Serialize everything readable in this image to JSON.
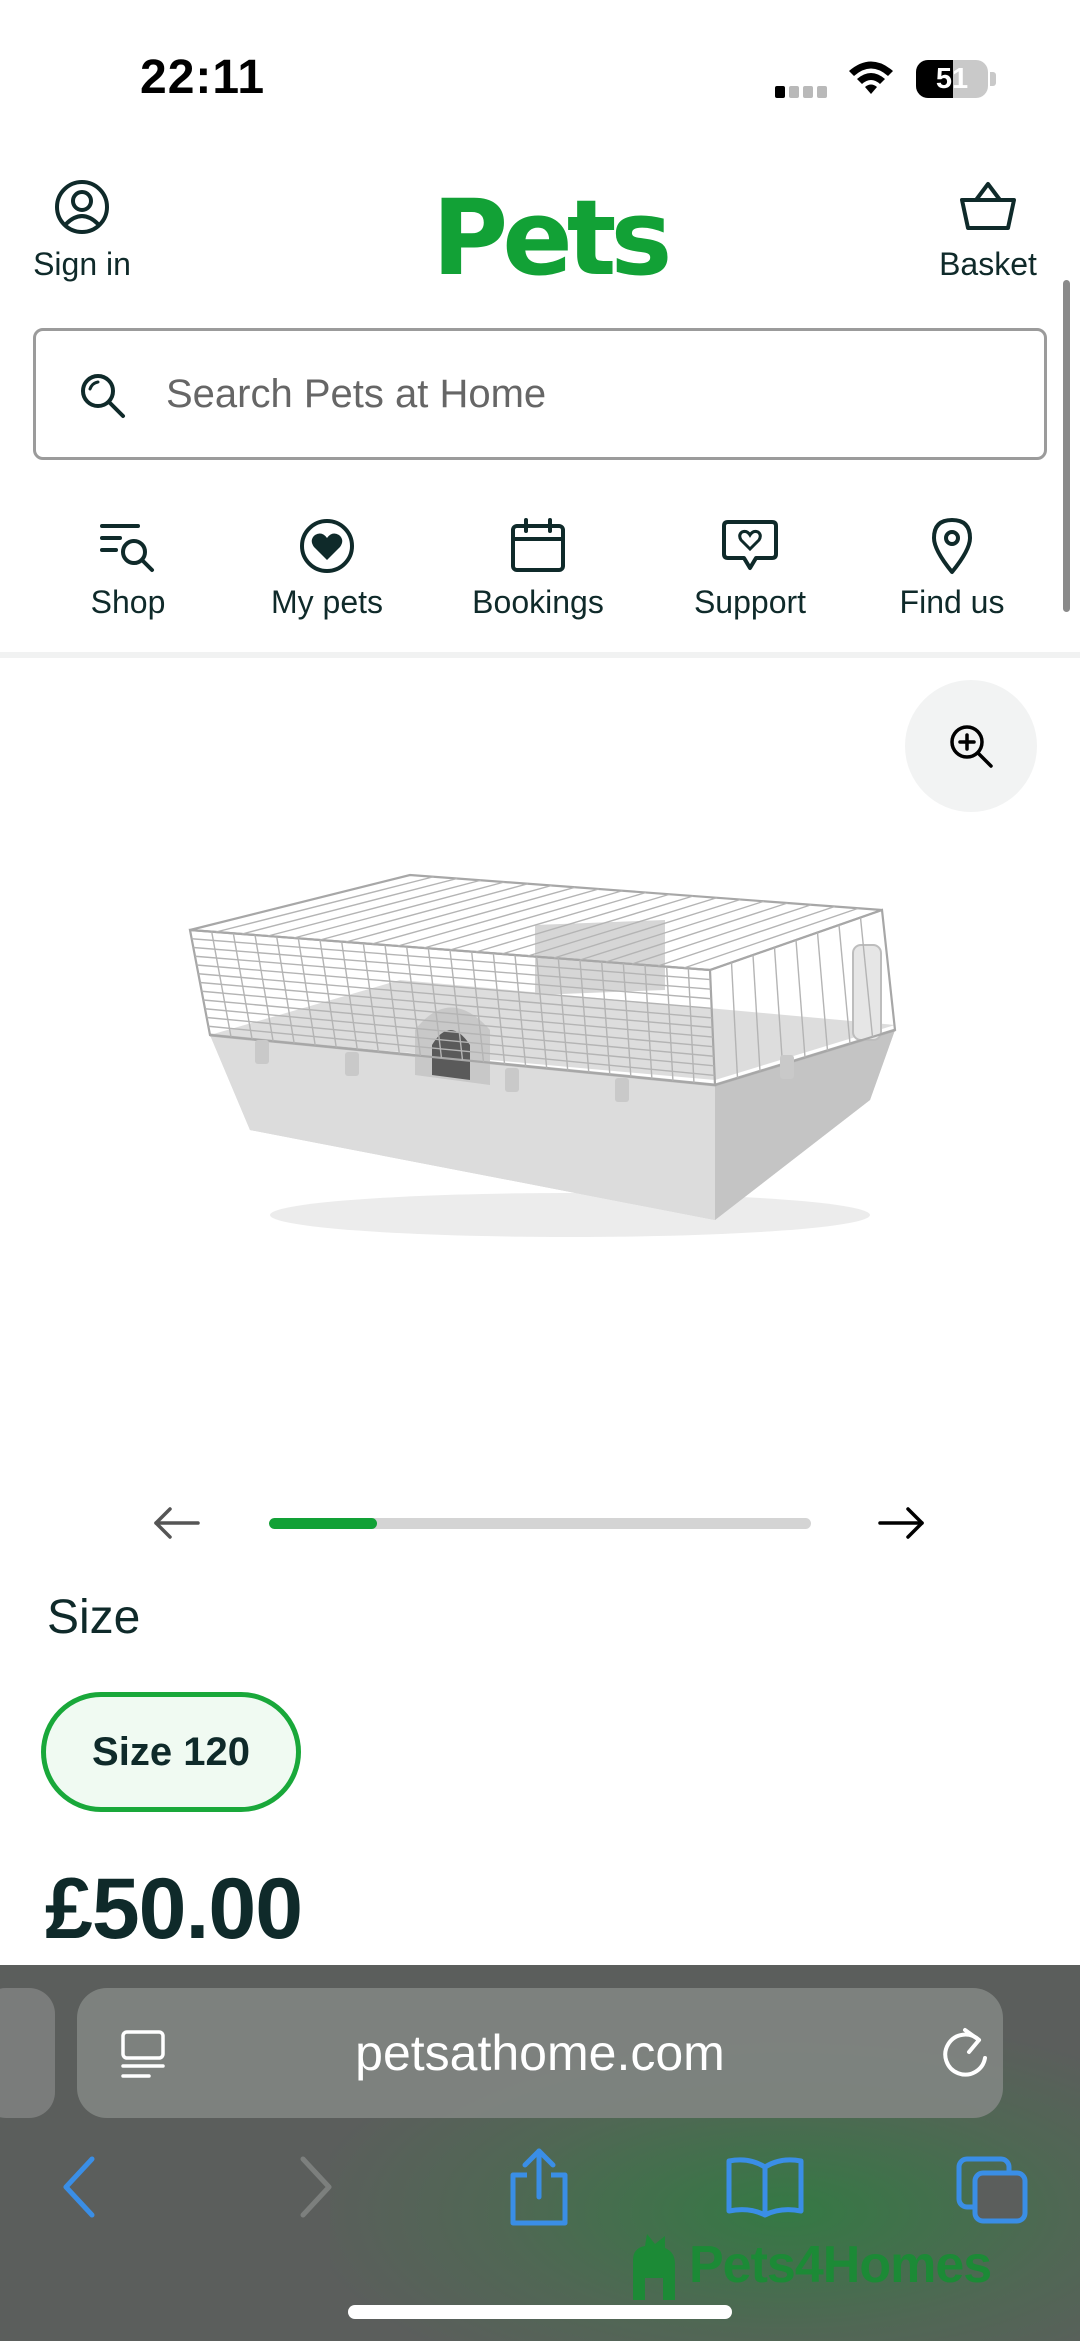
{
  "status_bar": {
    "time": "22:11",
    "battery_level": "51",
    "battery_fraction": 0.51
  },
  "header": {
    "sign_in_label": "Sign in",
    "logo_text": "Pets",
    "basket_label": "Basket"
  },
  "search": {
    "placeholder": "Search Pets at Home"
  },
  "nav": [
    {
      "label": "Shop",
      "icon": "shop-search-icon"
    },
    {
      "label": "My pets",
      "icon": "heart-icon"
    },
    {
      "label": "Bookings",
      "icon": "calendar-icon"
    },
    {
      "label": "Support",
      "icon": "chat-heart-icon"
    },
    {
      "label": "Find us",
      "icon": "location-pin-icon"
    }
  ],
  "gallery": {
    "progress": 0.2
  },
  "product": {
    "size_heading": "Size",
    "selected_size": "Size 120",
    "price": "£50.00"
  },
  "browser": {
    "url": "petsathome.com"
  },
  "watermark": {
    "text": "Pets4Homes"
  },
  "colors": {
    "brand_green": "#12a136",
    "text_dark": "#0f2a2a",
    "safari_blue": "#3a8ee6"
  }
}
